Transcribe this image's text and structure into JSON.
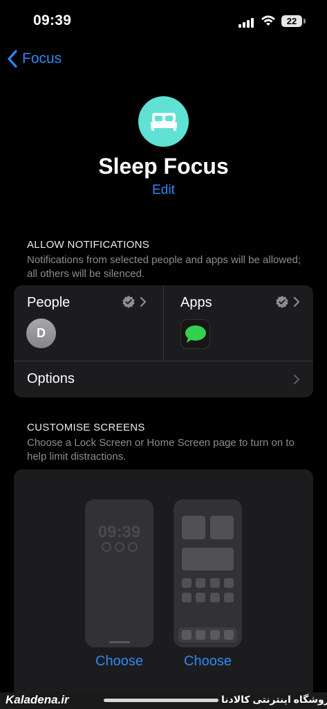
{
  "status_bar": {
    "time": "09:39",
    "battery": "22"
  },
  "nav": {
    "back_label": "Focus"
  },
  "header": {
    "title": "Sleep Focus",
    "edit_label": "Edit"
  },
  "allow_notifications": {
    "header": "ALLOW NOTIFICATIONS",
    "description": "Notifications from selected people and apps will be allowed; all others will be silenced.",
    "people_label": "People",
    "people_avatar_initial": "D",
    "apps_label": "Apps",
    "options_label": "Options"
  },
  "customise_screens": {
    "header": "CUSTOMISE SCREENS",
    "description": "Choose a Lock Screen or Home Screen page to turn on to help limit distractions.",
    "lock_screen_time": "09:39",
    "lock_choose_label": "Choose",
    "home_choose_label": "Choose"
  },
  "watermark": {
    "left": "Kaladena.ir",
    "right": "فروشگاه اینترنتی کالادنا"
  },
  "colors": {
    "accent": "#2e89f4",
    "focus_icon_bg": "#5fe1d4",
    "card_bg": "#1c1c1e"
  },
  "icons": [
    "chevron-left-icon",
    "bed-icon",
    "verified-badge-icon",
    "chevron-right-icon",
    "messages-icon",
    "cellular-signal-icon",
    "wifi-icon",
    "battery-icon"
  ]
}
